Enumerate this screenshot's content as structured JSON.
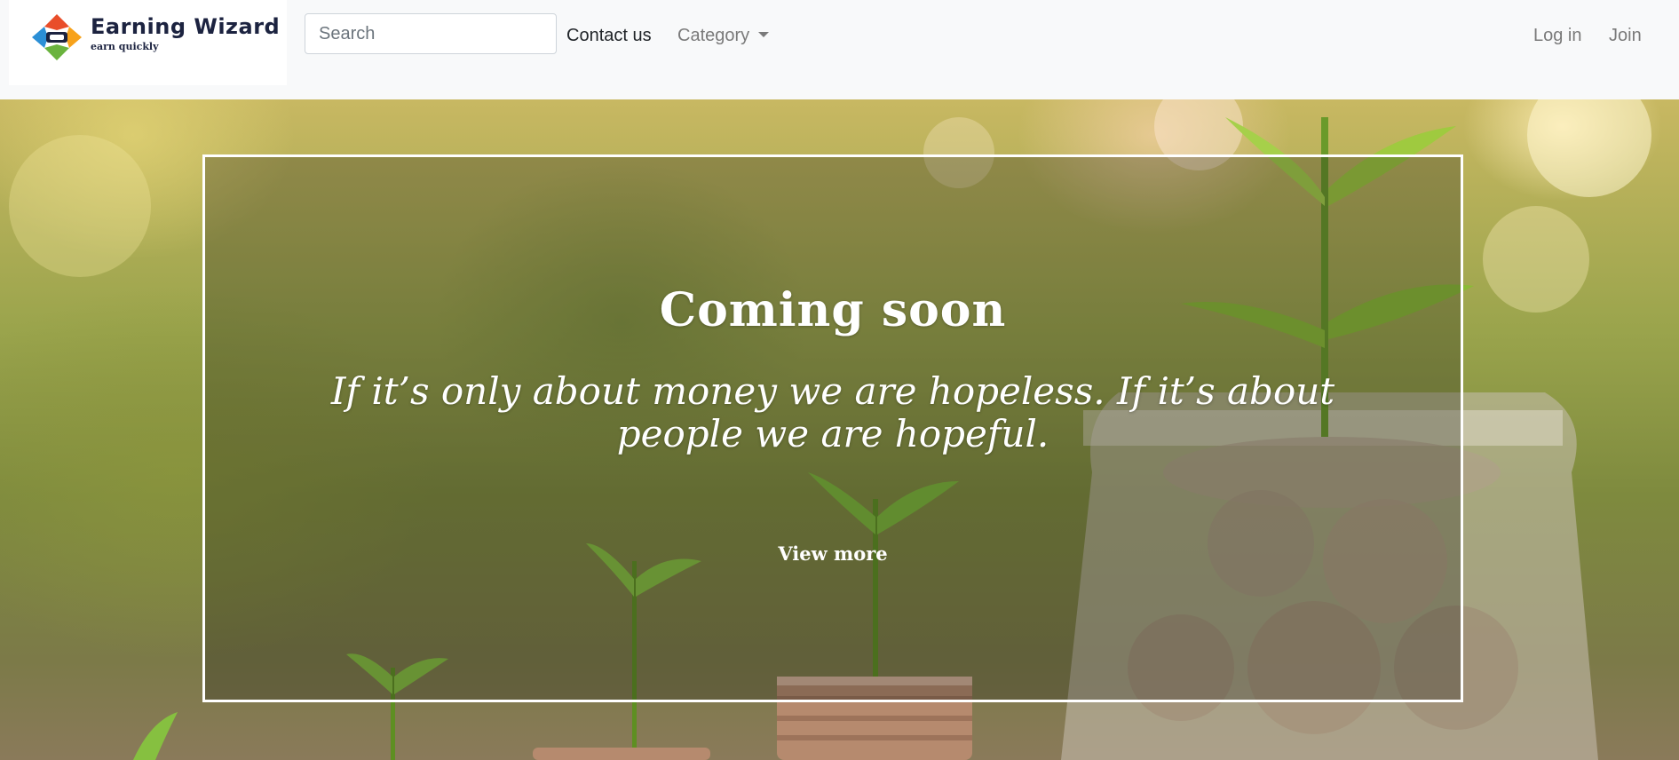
{
  "brand": {
    "name": "Earning Wizard",
    "tagline": "earn quickly",
    "colors": [
      "#e94e2a",
      "#f7a21b",
      "#2b8fd6",
      "#6ab33e"
    ]
  },
  "nav": {
    "search_placeholder": "Search",
    "search_value": "",
    "contact_label": "Contact us",
    "category_label": "Category",
    "login_label": "Log in",
    "join_label": "Join"
  },
  "hero": {
    "title": "Coming soon",
    "quote": "If it’s only about money we are hopeless. If it’s about people we are hopeful.",
    "cta_label": "View more",
    "background": "money-jar-with-plants"
  }
}
